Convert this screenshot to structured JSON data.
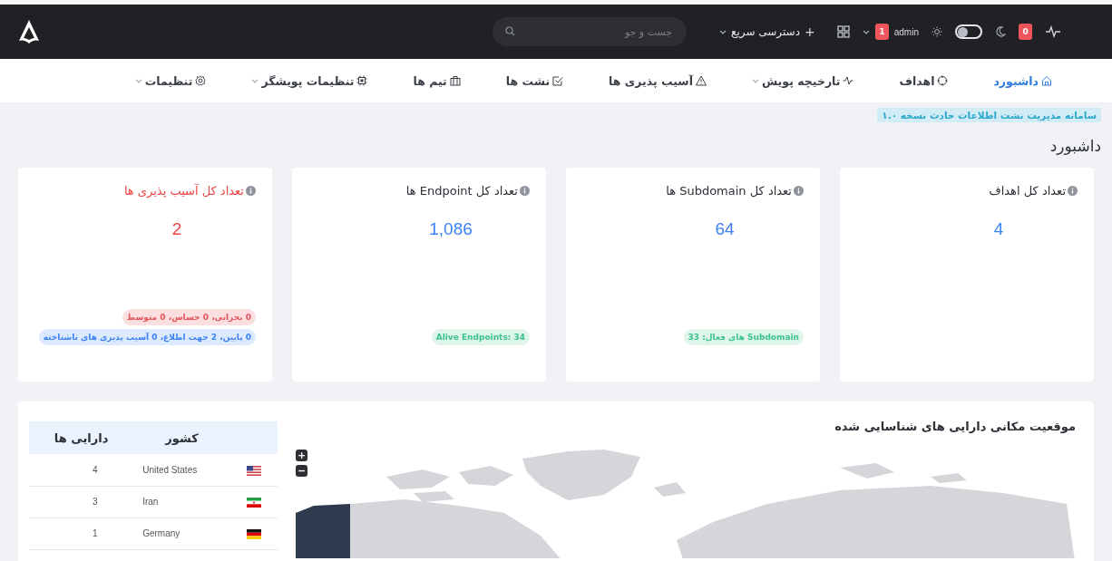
{
  "header": {
    "notifications": {
      "count": "0"
    },
    "theme": {
      "dark_mode": false
    },
    "user": {
      "name": "admin",
      "badge": "1"
    },
    "quick_access": {
      "icon": "+",
      "label": "دسترسی سریع"
    },
    "search": {
      "placeholder": "جست و جو"
    }
  },
  "nav": [
    {
      "label": "داشبورد",
      "selected": true,
      "dropdown": false
    },
    {
      "label": "اهداف",
      "selected": false,
      "dropdown": false
    },
    {
      "label": "تارخیچه پویش",
      "selected": false,
      "dropdown": true
    },
    {
      "label": "آسیب پذیری ها",
      "selected": false,
      "dropdown": false
    },
    {
      "label": "نشت ها",
      "selected": false,
      "dropdown": false
    },
    {
      "label": "تیم ها",
      "selected": false,
      "dropdown": false
    },
    {
      "label": "تنظیمات پویشگر",
      "selected": false,
      "dropdown": true
    },
    {
      "label": "تنظیمات",
      "selected": false,
      "dropdown": true
    }
  ],
  "version_badge": "سامانه مدیریت نشت اطلاعات حادث نسخه ۱.۰",
  "page_title": "داشبورد",
  "cards": [
    {
      "title": "تعداد کل اهداف",
      "value": "4",
      "color": "#3b82f6"
    },
    {
      "title": "تعداد کل Subdomain ها",
      "value": "64",
      "color": "#3b82f6",
      "pills": [
        {
          "kind": "success",
          "text": "Subdomain های فعال: 33"
        }
      ]
    },
    {
      "title": "تعداد کل Endpoint ها",
      "value": "1,086",
      "color": "#3b82f6",
      "pills": [
        {
          "kind": "success",
          "text": "Alive Endpoints: 34"
        }
      ]
    },
    {
      "title": "تعداد کل آسیب پذیری ها",
      "value": "2",
      "color": "#ef4444",
      "pills": [
        {
          "kind": "danger",
          "text": "0 بحرانی، 0 حساس، 0 متوسط"
        },
        {
          "kind": "info",
          "text": "0 پایین، 2 جهت اطلاع، 0 آسیب پذیری های ناشناخته"
        }
      ]
    }
  ],
  "map_panel": {
    "title": "موقعیت مکانی دارایی های شناسایی شده",
    "zoom_in": "+",
    "zoom_out": "−",
    "table": {
      "columns": [
        "کشور",
        "دارایی ها"
      ],
      "rows": [
        {
          "kind": "us",
          "country": "United States",
          "assets": "4"
        },
        {
          "kind": "ir",
          "country": "Iran",
          "assets": "3"
        },
        {
          "kind": "de",
          "country": "Germany",
          "assets": "1"
        }
      ]
    }
  }
}
